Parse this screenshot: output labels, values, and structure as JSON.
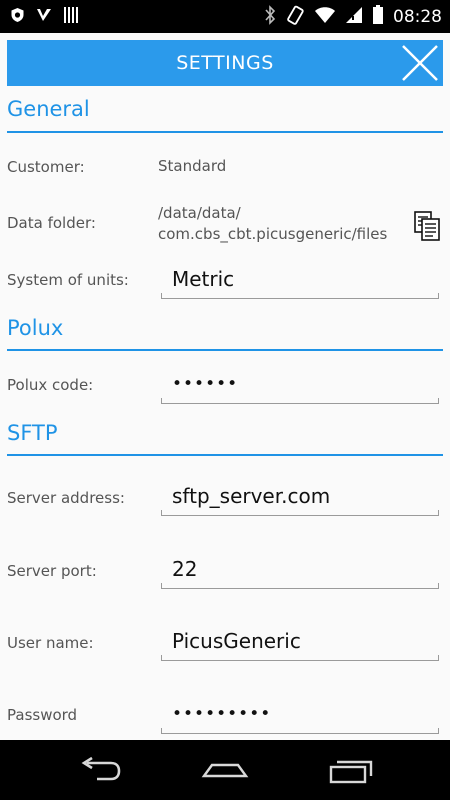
{
  "status_bar": {
    "time": "08:28",
    "left_icons": [
      "shield-icon",
      "check-icon",
      "barcode-icon"
    ],
    "right_icons": [
      "bluetooth-icon",
      "rotate-icon",
      "wifi-icon",
      "signal-icon",
      "battery-icon"
    ]
  },
  "header": {
    "title": "SETTINGS"
  },
  "sections": {
    "general": {
      "title": "General",
      "customer_label": "Customer:",
      "customer_value": "Standard",
      "data_folder_label": "Data folder:",
      "data_folder_line1": "/data/data/",
      "data_folder_line2": "com.cbs_cbt.picusgeneric/files",
      "units_label": "System of units:",
      "units_value": "Metric"
    },
    "polux": {
      "title": "Polux",
      "code_label": "Polux code:",
      "code_value": "••••••"
    },
    "sftp": {
      "title": "SFTP",
      "server_label": "Server address:",
      "server_value": "sftp_server.com",
      "port_label": "Server port:",
      "port_value": "22",
      "user_label": "User name:",
      "user_value": "PicusGeneric",
      "password_label": "Password",
      "password_value": "•••••••••"
    }
  },
  "colors": {
    "accent": "#2b9aeb",
    "section": "#1f93e6"
  }
}
